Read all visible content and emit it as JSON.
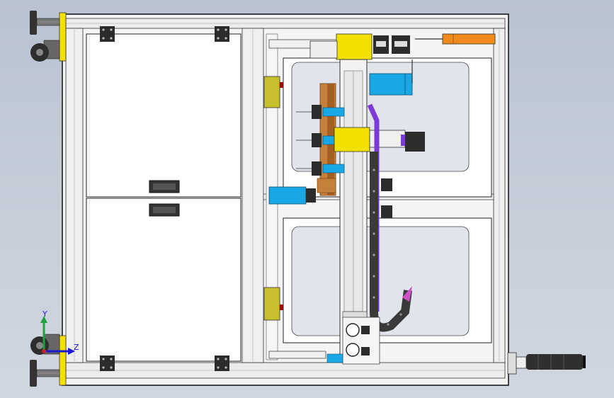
{
  "viewport": {
    "background_top": "#b9c2d1",
    "background_bottom": "#d1d7e1"
  },
  "colors": {
    "frame_fill": "#f4f4f4",
    "frame_stroke": "#1a1a1a",
    "panel_fill": "#ffffff",
    "yellow": "#f2e000",
    "olive": "#c7bf2c",
    "blue": "#1aa7e6",
    "orange": "#f08a1c",
    "purple": "#7d3bd6",
    "copper": "#c7803c",
    "dark": "#333333",
    "glass": "#e2e4ec"
  },
  "triad": {
    "x_label": "",
    "y_label": "Y",
    "z_label": "Z",
    "y_color": "#1fa23a",
    "z_color": "#1a1ad0",
    "x_color": "#d02020"
  },
  "icons": [
    "leveling-foot-icon",
    "caster-wheel-icon",
    "hinge-bracket-icon",
    "door-handle-icon",
    "signal-tower-light-icon",
    "coordinate-triad-icon"
  ]
}
